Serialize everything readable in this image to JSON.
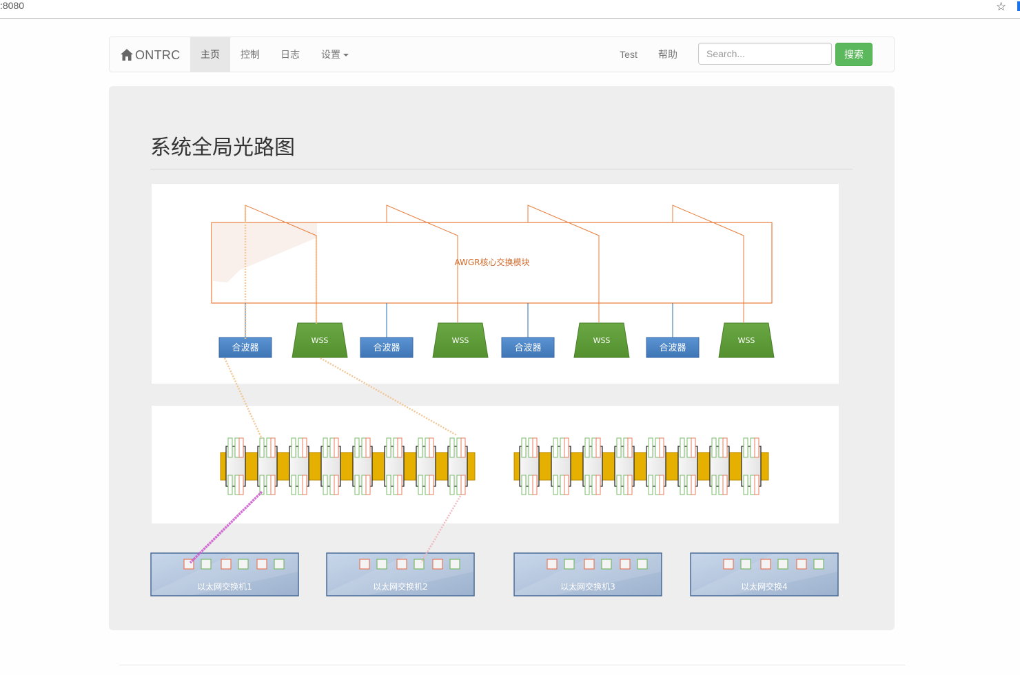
{
  "browser": {
    "url": ":8080"
  },
  "navbar": {
    "brand": "ONTRC",
    "items": [
      {
        "label": "主页",
        "active": true
      },
      {
        "label": "控制"
      },
      {
        "label": "日志"
      },
      {
        "label": "设置"
      }
    ],
    "right_links": [
      "Test",
      "帮助"
    ],
    "search": {
      "placeholder": "Search...",
      "button": "搜索"
    }
  },
  "page": {
    "title": "系统全局光路图"
  },
  "diagram": {
    "awgr_label": "AWGR核心交换模块",
    "bottom_modules": [
      {
        "type": "combiner",
        "label": "合波器"
      },
      {
        "type": "wss",
        "label": "WSS"
      },
      {
        "type": "combiner",
        "label": "合波器"
      },
      {
        "type": "wss",
        "label": "WSS"
      },
      {
        "type": "combiner",
        "label": "合波器"
      },
      {
        "type": "wss",
        "label": "WSS"
      },
      {
        "type": "combiner",
        "label": "合波器"
      },
      {
        "type": "wss",
        "label": "WSS"
      }
    ],
    "transceiver_groups": 2,
    "transceivers_per_group": 8,
    "switches": [
      {
        "label": "以太网交换机1"
      },
      {
        "label": "以太网交换机2"
      },
      {
        "label": "以太网交换机3"
      },
      {
        "label": "以太网交换4"
      }
    ],
    "colors": {
      "orange": "#e87c3a",
      "blue_line": "#4a86c0",
      "combiner": "#4f86c6",
      "wss": "#5f9a3a",
      "gold": "#e6b000",
      "switch_fill": "#a9bcd5",
      "switch_border": "#4a6a96",
      "port_red": "#e8795a",
      "port_green": "#7ab86a",
      "magenta": "#cc55cc"
    }
  }
}
